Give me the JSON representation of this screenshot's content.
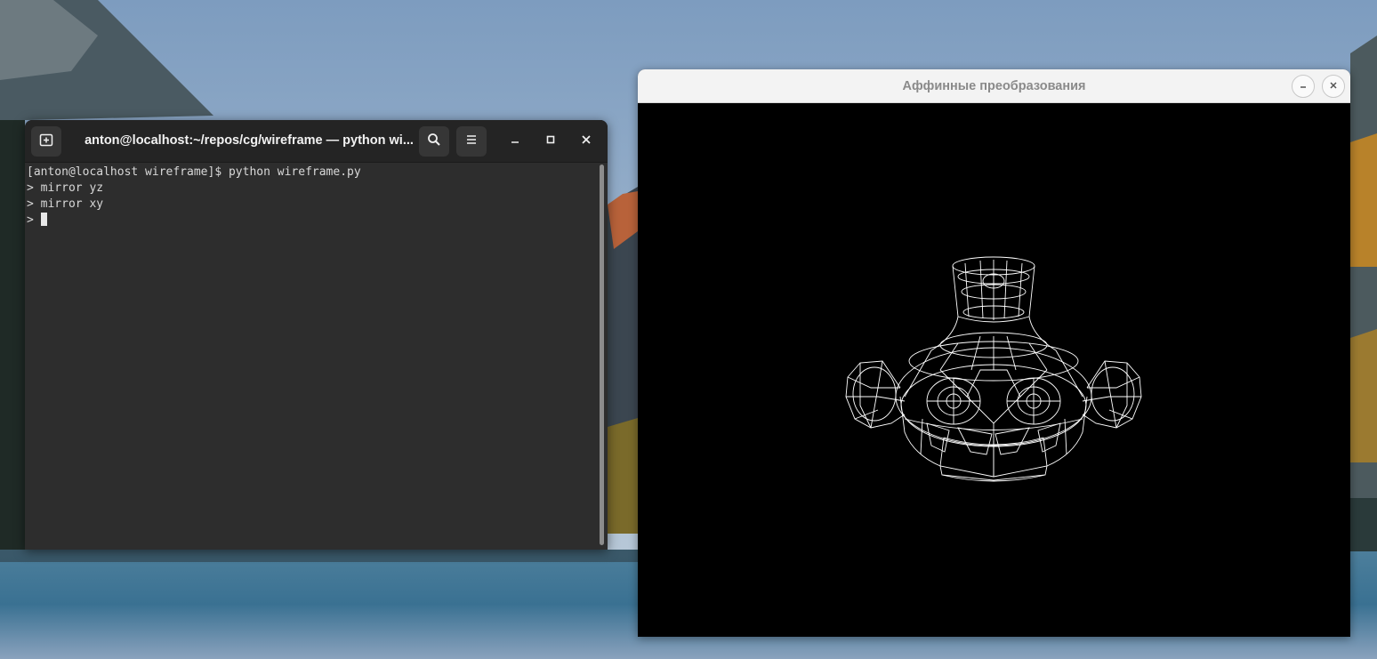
{
  "terminal": {
    "title": "anton@localhost:~/repos/cg/wireframe — python wi...",
    "lines": [
      "[anton@localhost wireframe]$ python wireframe.py",
      "> mirror yz",
      "> mirror xy",
      "> "
    ],
    "icons": {
      "new_tab": "new-tab-icon",
      "search": "search-icon",
      "menu": "hamburger-menu-icon",
      "minimize": "minimize-icon",
      "maximize": "maximize-icon",
      "close": "close-icon"
    }
  },
  "graphics_window": {
    "title": "Аффинные преобразования",
    "icons": {
      "minimize": "minimize-icon",
      "close": "close-icon"
    }
  },
  "colors": {
    "terminal_bg": "#2d2d2d",
    "terminal_header": "#242424",
    "canvas_bg": "#000000",
    "wireframe": "#ffffff"
  }
}
